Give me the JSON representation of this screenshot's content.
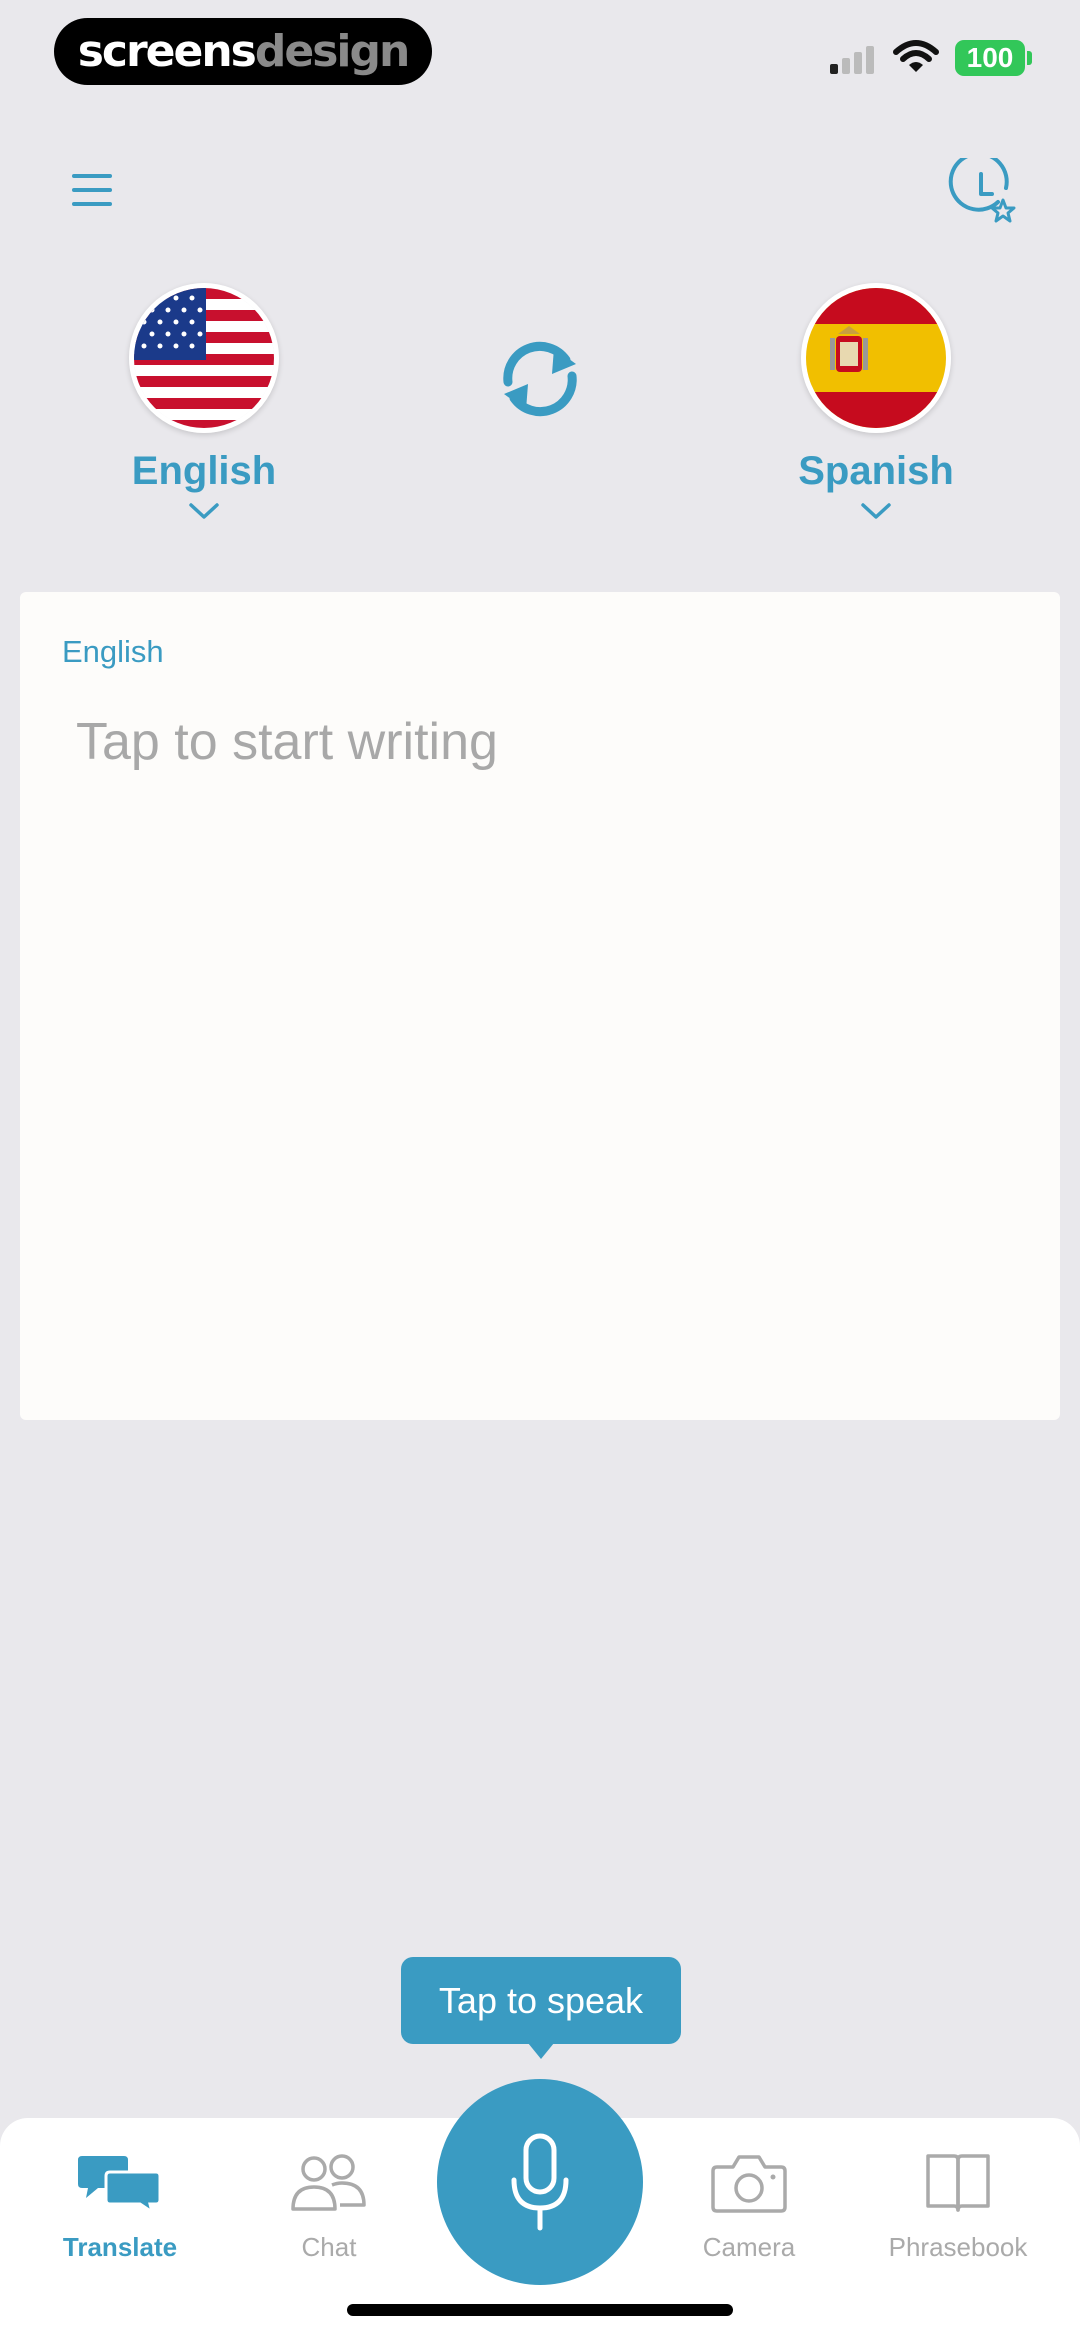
{
  "status_bar": {
    "brand_part1": "screens",
    "brand_part2": "design",
    "battery": "100"
  },
  "header": {
    "menu_icon": "hamburger-menu-icon",
    "history_icon": "history-favorites-icon"
  },
  "languages": {
    "source": {
      "name": "English",
      "flag": "us-flag"
    },
    "target": {
      "name": "Spanish",
      "flag": "spain-flag"
    },
    "swap_icon": "swap-arrows-icon"
  },
  "input_card": {
    "language_label": "English",
    "placeholder": "Tap to start writing"
  },
  "tooltip": "Tap to speak",
  "tabs": [
    {
      "label": "Translate",
      "icon": "chat-bubbles-icon",
      "active": true
    },
    {
      "label": "Chat",
      "icon": "people-icon",
      "active": false
    },
    {
      "label": "Camera",
      "icon": "camera-icon",
      "active": false
    },
    {
      "label": "Phrasebook",
      "icon": "book-icon",
      "active": false
    }
  ],
  "colors": {
    "accent": "#3a9bc2",
    "background": "#e9e8ec",
    "inactive": "#aaaaaa",
    "battery": "#32c759"
  }
}
